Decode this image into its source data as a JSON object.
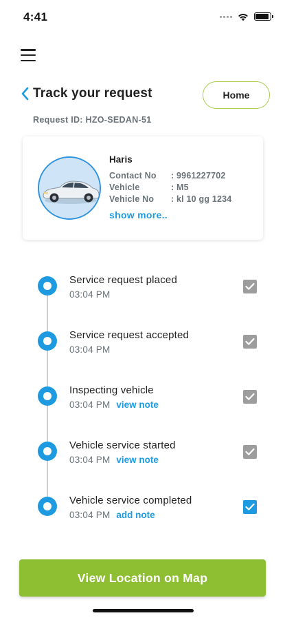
{
  "status_bar": {
    "time": "4:41",
    "battery_level": 0.9
  },
  "header": {
    "menu_icon": "hamburger-icon",
    "back_icon": "chevron-left-icon",
    "title": "Track your request",
    "home_label": "Home"
  },
  "request": {
    "id_text": "Request ID: HZO-SEDAN-51"
  },
  "vehicle_card": {
    "avatar_icon": "car-image",
    "name": "Haris",
    "rows": [
      {
        "label": "Contact No",
        "value": ": 9961227702"
      },
      {
        "label": "Vehicle",
        "value": ": M5"
      },
      {
        "label": "Vehicle  No",
        "value": ": kl 10 gg 1234"
      }
    ],
    "show_more": "show more.."
  },
  "timeline": {
    "steps": [
      {
        "title": "Service request placed",
        "time": "03:04 PM",
        "link": "",
        "checked": true,
        "active": false
      },
      {
        "title": "Service request accepted",
        "time": "03:04 PM",
        "link": "",
        "checked": true,
        "active": false
      },
      {
        "title": "Inspecting vehicle",
        "time": "03:04 PM",
        "link": "view note",
        "checked": true,
        "active": false
      },
      {
        "title": "Vehicle service started",
        "time": "03:04 PM",
        "link": "view note",
        "checked": true,
        "active": false
      },
      {
        "title": "Vehicle service completed",
        "time": "03:04 PM",
        "link": "add note",
        "checked": true,
        "active": true
      }
    ]
  },
  "footer": {
    "map_button": "View Location on Map"
  },
  "colors": {
    "accent_blue": "#1e9be0",
    "accent_green": "#8ebf32",
    "home_border": "#a8cf53",
    "muted_text": "#6a7378",
    "check_grey": "#9d9d9d"
  }
}
